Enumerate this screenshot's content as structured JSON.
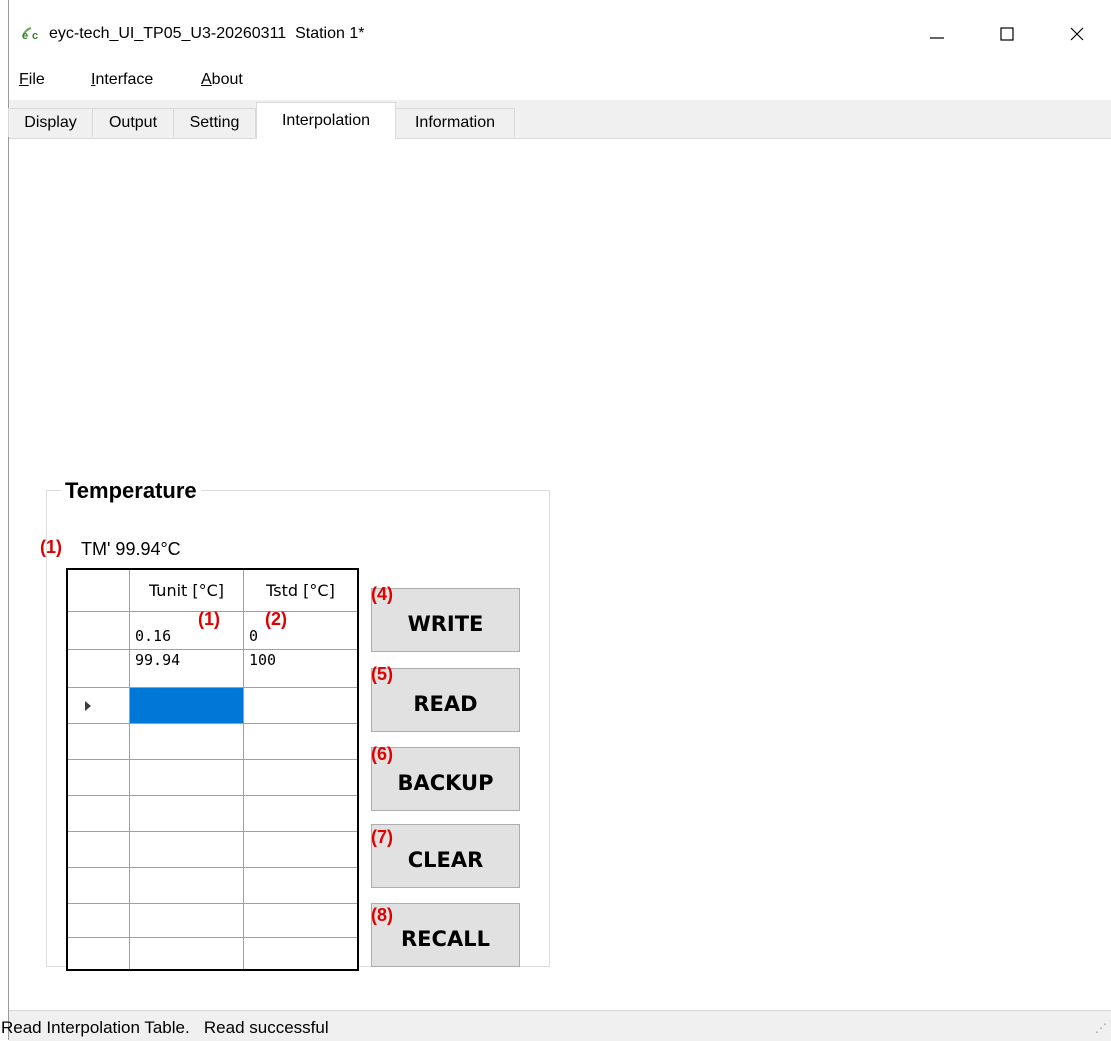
{
  "window": {
    "title": "eyc-tech_UI_TP05_U3-20260311  Station 1*",
    "brand_color": "#6aa84f",
    "controls": [
      "minimize-icon",
      "maximize-icon",
      "close-icon"
    ]
  },
  "menu": {
    "items": [
      {
        "first": "F",
        "rest": "ile"
      },
      {
        "first": "I",
        "rest": "nterface"
      },
      {
        "first": "A",
        "rest": "bout"
      }
    ]
  },
  "tabs": [
    {
      "label": "Display"
    },
    {
      "label": "Output"
    },
    {
      "label": "Setting"
    },
    {
      "label": "Interpolation",
      "active": true
    },
    {
      "label": "Information"
    }
  ],
  "temperature": {
    "group_title": "Temperature",
    "tm_label": "TM' 99.94°C",
    "table": {
      "headers": [
        "Tunit [°C]",
        "Tstd [°C]"
      ],
      "rows": [
        [
          "0.16",
          "0"
        ],
        [
          "99.94",
          "100"
        ],
        [
          "",
          ""
        ],
        [
          "",
          ""
        ],
        [
          "",
          ""
        ],
        [
          "",
          ""
        ],
        [
          "",
          ""
        ],
        [
          "",
          ""
        ],
        [
          "",
          ""
        ],
        [
          "",
          ""
        ]
      ],
      "selected_row": 2,
      "selection_color": "#0078d7"
    },
    "buttons": {
      "write": "WRITE",
      "read": "READ",
      "backup": "BACKUP",
      "clear": "CLEAR",
      "recall": "RECALL"
    }
  },
  "annotations": {
    "tm": "(1)",
    "col1": "(1)",
    "col2": "(2)",
    "write": "(4)",
    "read": "(5)",
    "backup": "(6)",
    "clear": "(7)",
    "recall": "(8)",
    "color": "#e00000"
  },
  "status": {
    "text": "Read Interpolation Table.   Read successful"
  }
}
